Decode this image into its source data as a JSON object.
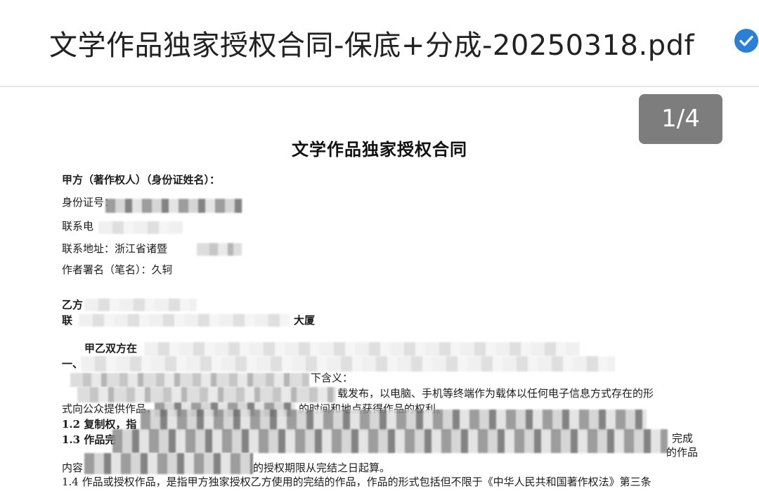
{
  "header": {
    "file_name": "文学作品独家授权合同-保底+分成-20250318.pdf",
    "status_icon": "check-circle-icon",
    "accent_color": "#2a7fd6"
  },
  "viewer": {
    "page_indicator": "1/4",
    "current_page": 1,
    "total_pages": 4
  },
  "document": {
    "title": "文学作品独家授权合同",
    "party_a": {
      "label_line": "甲方（著作权人）（身份证姓名）：",
      "id_label": "身份证号：",
      "phone_label": "联系电",
      "address_label": "联系地址：",
      "address_value": "浙江省诸暨",
      "pen_name_label": "作者署名（笔名）：",
      "pen_name_value": "久轲"
    },
    "party_b": {
      "label": "乙方",
      "contact_label": "联",
      "fragment": "大厦"
    },
    "clauses": {
      "intro_fragment": "甲乙双方在",
      "section_one_mark": "一、",
      "definitions_fragment": "下含义：",
      "publish_fragment": "载发布，以电脑、手机等终端作为载体以任何电子信息方式存在的形",
      "line_1_1_tail_start": "式向公众提供作品，",
      "line_1_1_tail_end": "的时间和地点获得作品的权利。",
      "clause_1_2": "1.2  复制权，指",
      "clause_1_3": "1.3  作品完",
      "clause_1_3_tail": "完成",
      "work_tail": "的作品",
      "content_fragment": "内容",
      "term_fragment": "的授权期限从完结之日起算。",
      "clause_1_4": "1.4  作品或授权作品，是指甲方独家授权乙方使用的完结的作品，作品的形式包括但不限于《中华人民共和国著作权法》第三条"
    }
  }
}
